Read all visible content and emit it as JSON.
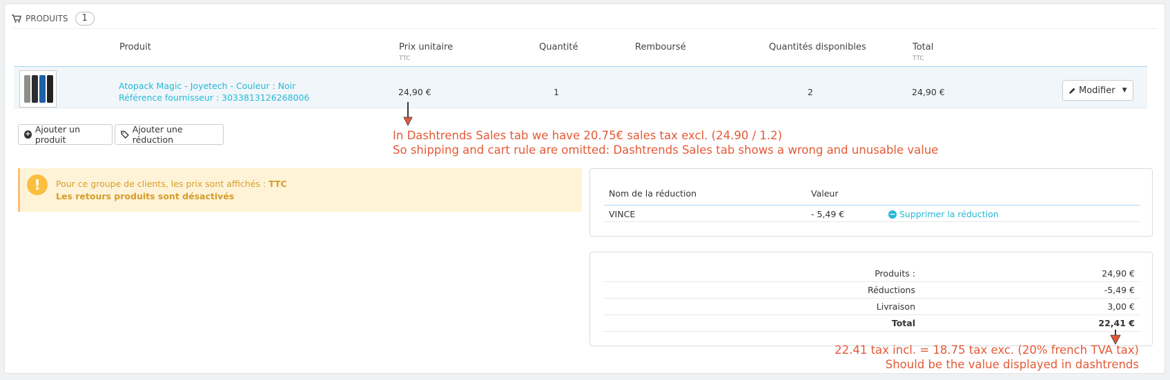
{
  "panel": {
    "title": "PRODUITS",
    "count": "1"
  },
  "table": {
    "headers": {
      "produit": "Produit",
      "prix": "Prix unitaire",
      "prix_sub": "TTC",
      "quantite": "Quantité",
      "rembourse": "Remboursé",
      "dispo": "Quantités disponibles",
      "total": "Total",
      "total_sub": "TTC"
    },
    "row": {
      "name": "Atopack Magic - Joyetech - Couleur : Noir",
      "ref": "Référence fournisseur : 3033813126268006",
      "price": "24,90 €",
      "qty": "1",
      "available": "2",
      "total": "24,90 €",
      "modify_label": "Modifier"
    }
  },
  "actions": {
    "add_product": "Ajouter un produit",
    "add_discount": "Ajouter une réduction"
  },
  "alert": {
    "line1_prefix": "Pour ce groupe de clients, les prix sont affichés : ",
    "line1_bold": "TTC",
    "line2": "Les retours produits sont désactivés"
  },
  "discounts": {
    "col_name": "Nom de la réduction",
    "col_value": "Valeur",
    "rows": [
      {
        "name": "VINCE",
        "value": "- 5,49 €",
        "action": "Supprimer la réduction"
      }
    ]
  },
  "summary": {
    "rows": [
      {
        "label": "Produits :",
        "value": "24,90 €"
      },
      {
        "label": "Réductions",
        "value": "-5,49 €"
      },
      {
        "label": "Livraison",
        "value": "3,00 €"
      },
      {
        "label": "Total",
        "value": "22,41 €"
      }
    ]
  },
  "annotations": {
    "note1_line1": "In Dashtrends Sales tab we have 20.75€ sales tax excl. (24.90 / 1.2)",
    "note1_line2": "So shipping and cart rule are omitted: Dashtrends Sales tab shows a wrong and unusable value",
    "note2_line1": "22.41 tax incl. = 18.75 tax exc. (20% french TVA tax)",
    "note2_line2": "Should be the value displayed in dashtrends"
  },
  "colors": {
    "link": "#25b9d7",
    "annotation": "#e35a36",
    "alert_bg": "#fff3d7",
    "alert_text": "#d49d2a"
  }
}
